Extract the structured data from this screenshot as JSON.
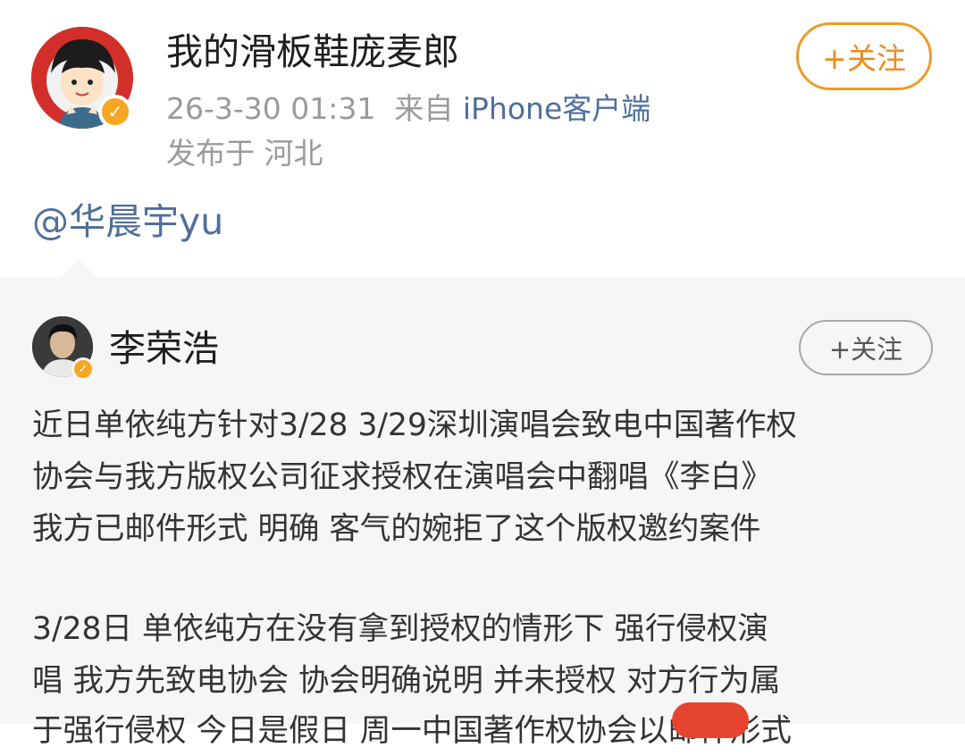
{
  "post": {
    "username": "我的滑板鞋庞麦郎",
    "timestamp": "26-3-30 01:31",
    "source_prefix": "来自",
    "source": "iPhone客户端",
    "location": "发布于 河北",
    "follow_label": "+关注",
    "mention": "@华晨宇yu"
  },
  "repost": {
    "username": "李荣浩",
    "follow_label": "+关注",
    "lines": [
      "近日单依纯方针对3/28 3/29深圳演唱会致电中国著作权",
      "协会与我方版权公司征求授权在演唱会中翻唱《李白》",
      "我方已邮件形式 明确 客气的婉拒了这个版权邀约案件",
      "",
      "3/28日 单依纯方在没有拿到授权的情形下 强行侵权演",
      "唱  我方先致电协会 协会明确说明 并未授权 对方行为属",
      "于强行侵权 今日是假日 周一中国著作权协会以邮件形式"
    ]
  },
  "colors": {
    "accent_orange": "#ee8a1b",
    "link_blue": "#4f6f9c",
    "verified_badge": "#f5a623"
  }
}
